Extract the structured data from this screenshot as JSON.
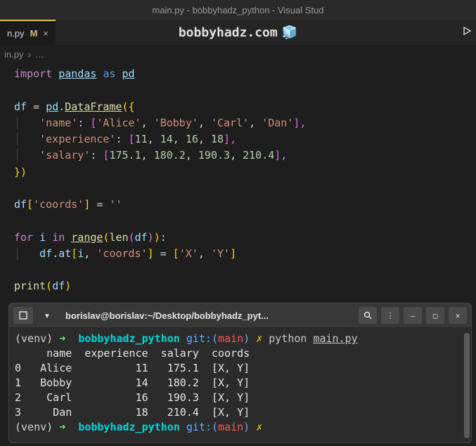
{
  "window": {
    "title": "main.py - bobbyhadz_python - Visual Stud"
  },
  "tab": {
    "filename": "n.py",
    "modified": "M",
    "close": "×"
  },
  "overlay": {
    "text": "bobbyhadz.com",
    "icon": "🧊"
  },
  "breadcrumb": {
    "file": "in.py",
    "sep": "›",
    "dots": "…"
  },
  "code": {
    "l1": {
      "import": "import",
      "pandas": "pandas",
      "as": "as",
      "pd": "pd"
    },
    "l3": {
      "df": "df",
      "eq": "=",
      "pd": "pd",
      "dot": ".",
      "DataFrame": "DataFrame",
      "open": "({"
    },
    "l4": {
      "k": "'name'",
      "c": ":",
      "o": "[",
      "a": "'Alice'",
      "b": "'Bobby'",
      "cc": "'Carl'",
      "d": "'Dan'",
      "close": "],",
      "com": ","
    },
    "l5": {
      "k": "'experience'",
      "c": ":",
      "o": "[",
      "a": "11",
      "b": "14",
      "c2": "16",
      "d": "18",
      "close": "],",
      "com": ","
    },
    "l6": {
      "k": "'salary'",
      "c": ":",
      "o": "[",
      "a": "175.1",
      "b": "180.2",
      "c2": "190.3",
      "d": "210.4",
      "close": "],",
      "com": ","
    },
    "l7": {
      "close": "})"
    },
    "l9": {
      "df": "df",
      "o": "[",
      "k": "'coords'",
      "c": "]",
      "eq": "=",
      "v": "''"
    },
    "l11": {
      "for": "for",
      "i": "i",
      "in": "in",
      "range": "range",
      "len": "len",
      "df": "df",
      "end": ":"
    },
    "l12": {
      "df": "df",
      "at": "at",
      "o": "[",
      "i": "i",
      "com": ",",
      "k": "'coords'",
      "c": "]",
      "eq": "=",
      "o2": "[",
      "x": "'X'",
      "y": "'Y'",
      "c2": "]"
    },
    "l14": {
      "print": "print",
      "df": "df"
    }
  },
  "terminal": {
    "title": "borislav@borislav:~/Desktop/bobbyhadz_pyt...",
    "prompt": {
      "venv": "(venv)",
      "arrow": "➜",
      "proj": "bobbyhadz_python",
      "git": "git:(",
      "branch": "main",
      "gitc": ")",
      "x": "✗"
    },
    "cmd": {
      "python": "python",
      "file": "main.py"
    },
    "header_row": "     name  experience  salary  coords",
    "rows": [
      "0   Alice          11   175.1  [X, Y]",
      "1   Bobby          14   180.2  [X, Y]",
      "2    Carl          16   190.3  [X, Y]",
      "3     Dan          18   210.4  [X, Y]"
    ]
  }
}
